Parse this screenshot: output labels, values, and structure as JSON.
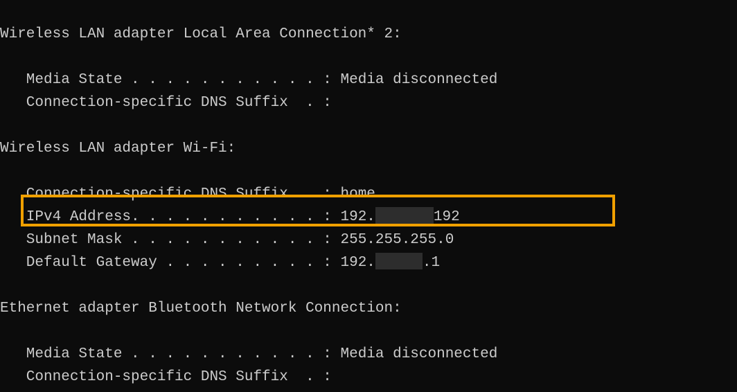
{
  "adapter1": {
    "header": "Wireless LAN adapter Local Area Connection* 2:",
    "media_state_label": "   Media State . . . . . . . . . . . : ",
    "media_state_value": "Media disconnected",
    "dns_suffix_label": "   Connection-specific DNS Suffix  . :",
    "dns_suffix_value": ""
  },
  "adapter2": {
    "header": "Wireless LAN adapter Wi-Fi:",
    "dns_suffix_label": "   Connection-specific DNS Suffix  . : ",
    "dns_suffix_value": "home",
    "ipv4_label": "   IPv4 Address. . . . . . . . . . . : ",
    "ipv4_value_pre": "192.",
    "ipv4_value_post": "192",
    "subnet_label": "   Subnet Mask . . . . . . . . . . . : ",
    "subnet_value": "255.255.255.0",
    "gateway_label": "   Default Gateway . . . . . . . . . : ",
    "gateway_value_pre": "192.",
    "gateway_value_post": ".1"
  },
  "adapter3": {
    "header": "Ethernet adapter Bluetooth Network Connection:",
    "media_state_label": "   Media State . . . . . . . . . . . : ",
    "media_state_value": "Media disconnected",
    "dns_suffix_label": "   Connection-specific DNS Suffix  . :",
    "dns_suffix_value": ""
  }
}
